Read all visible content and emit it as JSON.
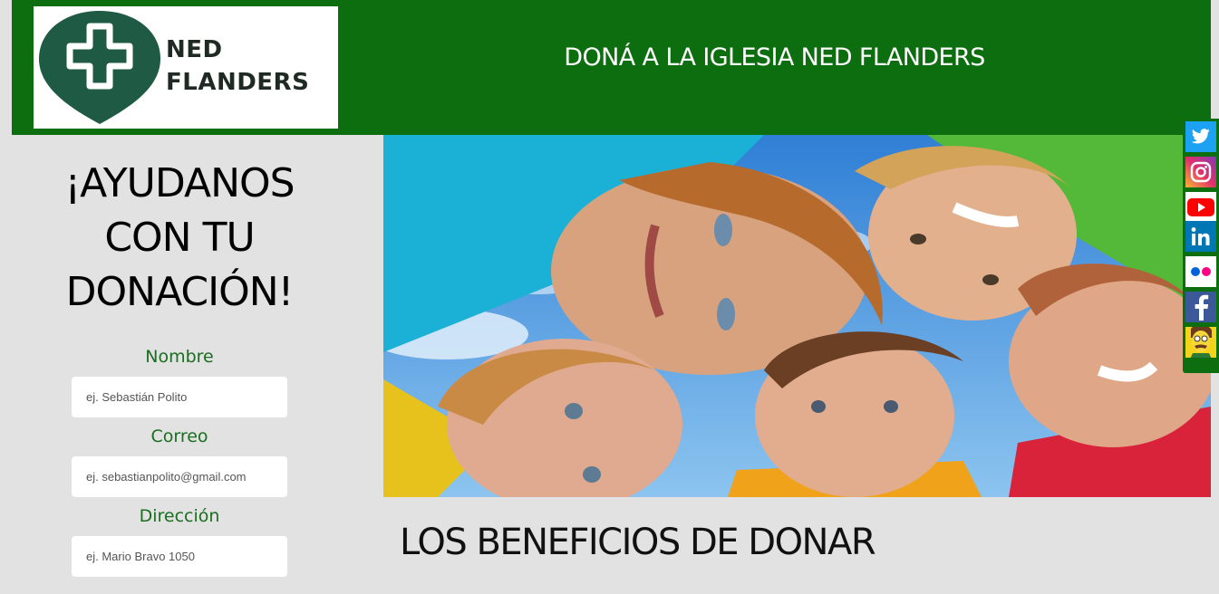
{
  "header": {
    "logo_line1": "NED",
    "logo_line2": "FLANDERS",
    "title": "DONÁ A LA IGLESIA NED FLANDERS"
  },
  "form": {
    "headline_line1": "¡AYUDANOS",
    "headline_line2": "CON TU",
    "headline_line3": "DONACIÓN!",
    "fields": [
      {
        "label": "Nombre",
        "placeholder": "ej. Sebastián Polito"
      },
      {
        "label": "Correo",
        "placeholder": "ej. sebastianpolito@gmail.com"
      },
      {
        "label": "Dirección",
        "placeholder": "ej. Mario Bravo 1050"
      }
    ]
  },
  "section": {
    "benefits_title": "LOS BENEFICIOS DE DONAR"
  },
  "social": [
    "twitter-icon",
    "instagram-icon",
    "youtube-icon",
    "linkedin-icon",
    "flickr-icon",
    "facebook-icon",
    "ned-avatar-icon"
  ],
  "colors": {
    "header_green": "#0d6e10",
    "label_green": "#1a6e1f",
    "page_background": "#e2e2e2"
  }
}
